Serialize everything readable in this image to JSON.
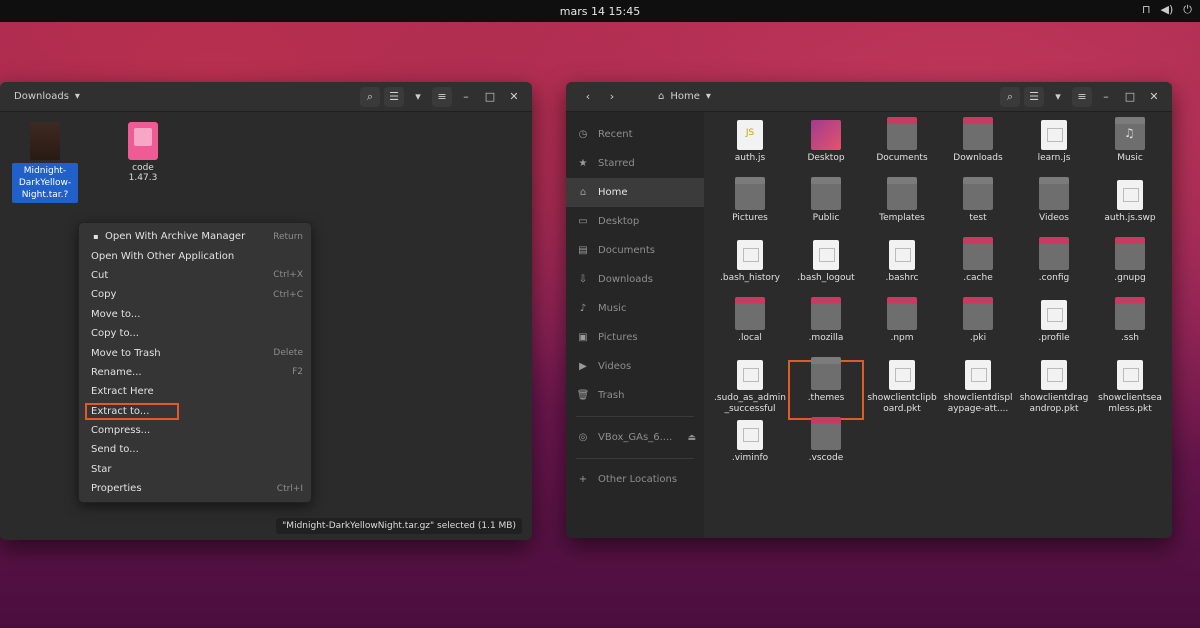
{
  "topbar": {
    "clock": "mars 14  15:45",
    "tray": [
      "⊓",
      "◀)",
      "⏻"
    ]
  },
  "left_window": {
    "path": "Downloads",
    "files": [
      {
        "name": "Midnight-DarkYellow-Night.tar.gz",
        "label": "Midnight-DarkYellow-Night.tar.?"
      },
      {
        "name": "code",
        "label": "code\n1.47.3"
      }
    ],
    "context_menu": [
      {
        "label": "Open With Archive Manager",
        "shortcut": "Return",
        "icon": "▪"
      },
      {
        "label": "Open With Other Application",
        "shortcut": ""
      },
      {
        "label": "Cut",
        "shortcut": "Ctrl+X"
      },
      {
        "label": "Copy",
        "shortcut": "Ctrl+C"
      },
      {
        "label": "Move to...",
        "shortcut": ""
      },
      {
        "label": "Copy to...",
        "shortcut": ""
      },
      {
        "label": "Move to Trash",
        "shortcut": "Delete"
      },
      {
        "label": "Rename...",
        "shortcut": "F2"
      },
      {
        "label": "Extract Here",
        "shortcut": ""
      },
      {
        "label": "Extract to...",
        "shortcut": "",
        "highlight": true
      },
      {
        "label": "Compress...",
        "shortcut": ""
      },
      {
        "label": "Send to...",
        "shortcut": ""
      },
      {
        "label": "Star",
        "shortcut": ""
      },
      {
        "label": "Properties",
        "shortcut": "Ctrl+I"
      }
    ],
    "status": "\"Midnight-DarkYellowNight.tar.gz\" selected (1.1 MB)"
  },
  "right_window": {
    "path": "Home",
    "sidebar": [
      {
        "label": "Recent",
        "icon": "◷"
      },
      {
        "label": "Starred",
        "icon": "★"
      },
      {
        "label": "Home",
        "icon": "⌂",
        "active": true
      },
      {
        "label": "Desktop",
        "icon": "▭"
      },
      {
        "label": "Documents",
        "icon": "▤"
      },
      {
        "label": "Downloads",
        "icon": "⇩"
      },
      {
        "label": "Music",
        "icon": "♪"
      },
      {
        "label": "Pictures",
        "icon": "▣"
      },
      {
        "label": "Videos",
        "icon": "▶"
      },
      {
        "label": "Trash",
        "icon": "🗑"
      },
      {
        "label": "VBox_GAs_6....",
        "icon": "◎",
        "eject": "⏏"
      },
      {
        "label": "Other Locations",
        "icon": "+"
      }
    ],
    "items": [
      {
        "name": "auth.js",
        "kind": "js"
      },
      {
        "name": "Desktop",
        "kind": "desktop"
      },
      {
        "name": "Documents",
        "kind": "folder"
      },
      {
        "name": "Downloads",
        "kind": "folder"
      },
      {
        "name": "learn.js",
        "kind": "file"
      },
      {
        "name": "Music",
        "kind": "folder-music"
      },
      {
        "name": "Pictures",
        "kind": "folder-plain"
      },
      {
        "name": "Public",
        "kind": "folder-plain"
      },
      {
        "name": "Templates",
        "kind": "folder-plain"
      },
      {
        "name": "test",
        "kind": "folder-plain"
      },
      {
        "name": "Videos",
        "kind": "folder-plain"
      },
      {
        "name": "auth.js.swp",
        "kind": "file"
      },
      {
        "name": ".bash_history",
        "kind": "file"
      },
      {
        "name": ".bash_logout",
        "kind": "file"
      },
      {
        "name": ".bashrc",
        "kind": "file"
      },
      {
        "name": ".cache",
        "kind": "folder"
      },
      {
        "name": ".config",
        "kind": "folder"
      },
      {
        "name": ".gnupg",
        "kind": "folder"
      },
      {
        "name": ".local",
        "kind": "folder"
      },
      {
        "name": ".mozilla",
        "kind": "folder"
      },
      {
        "name": ".npm",
        "kind": "folder"
      },
      {
        "name": ".pki",
        "kind": "folder"
      },
      {
        "name": ".profile",
        "kind": "file"
      },
      {
        "name": ".ssh",
        "kind": "folder"
      },
      {
        "name": ".sudo_as_admin_successful",
        "kind": "file"
      },
      {
        "name": ".themes",
        "kind": "folder-plain",
        "highlight": true
      },
      {
        "name": "showclientclipboard.pkt",
        "kind": "file"
      },
      {
        "name": "showclientdisplaypage-att....",
        "kind": "file"
      },
      {
        "name": "showclientdragandrop.pkt",
        "kind": "file"
      },
      {
        "name": "showclientseamless.pkt",
        "kind": "file"
      },
      {
        "name": ".viminfo",
        "kind": "file"
      },
      {
        "name": ".vscode",
        "kind": "folder"
      }
    ]
  },
  "colors": {
    "accent_select": "#2060c8",
    "highlight_box": "#e15a2c",
    "folder_tab": "#c93a63"
  }
}
